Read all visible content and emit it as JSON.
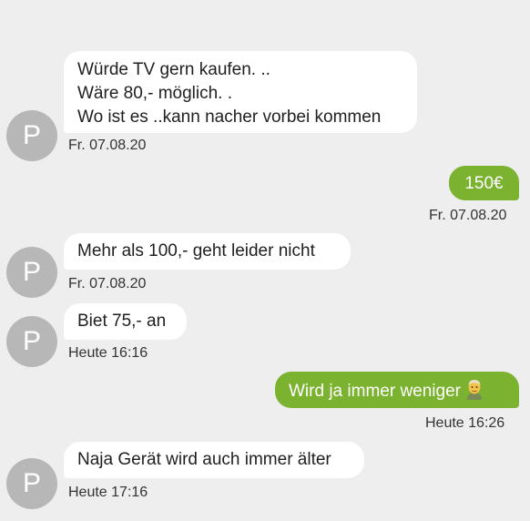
{
  "messages": [
    {
      "direction": "in",
      "avatar": "P",
      "lines": [
        "Würde TV gern kaufen. ..",
        "Wäre 80,- möglich. .",
        "Wo ist es ..kann nacher vorbei kommen"
      ],
      "time": "Fr. 07.08.20"
    },
    {
      "direction": "out",
      "text": "150€",
      "time": "Fr. 07.08.20"
    },
    {
      "direction": "in",
      "avatar": "P",
      "text": "Mehr als 100,- geht leider nicht",
      "time": "Fr. 07.08.20"
    },
    {
      "direction": "in",
      "avatar": "P",
      "text": "Biet 75,- an",
      "time": "Heute 16:16"
    },
    {
      "direction": "out",
      "text": "Wird ja immer weniger",
      "emoji": "older-man-emoji-icon",
      "time": "Heute 16:26"
    },
    {
      "direction": "in",
      "avatar": "P",
      "text": "Naja Gerät wird auch immer älter",
      "time": "Heute 17:16"
    }
  ],
  "colors": {
    "background": "#eeeeee",
    "incoming_bubble": "#ffffff",
    "outgoing_bubble": "#7bb22f",
    "avatar": "#b7b7b7"
  }
}
